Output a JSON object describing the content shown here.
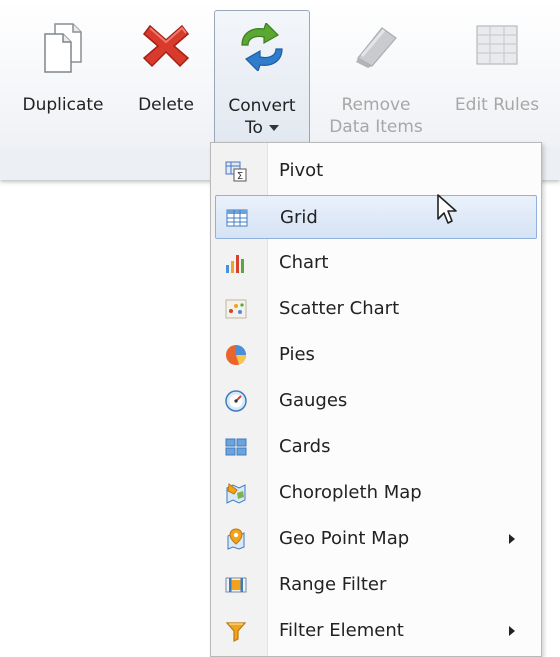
{
  "toolbar": {
    "duplicate_label": "Duplicate",
    "delete_label": "Delete",
    "convert_label_line1": "Convert",
    "convert_label_line2": "To",
    "remove_label_line1": "Remove",
    "remove_label_line2": "Data Items",
    "edit_rules_label": "Edit Rules"
  },
  "menu": {
    "items": [
      {
        "label": "Pivot",
        "icon": "pivot-icon"
      },
      {
        "label": "Grid",
        "icon": "grid-icon",
        "state": "hover"
      },
      {
        "label": "Chart",
        "icon": "chart-icon"
      },
      {
        "label": "Scatter Chart",
        "icon": "scatter-chart-icon"
      },
      {
        "label": "Pies",
        "icon": "pie-icon"
      },
      {
        "label": "Gauges",
        "icon": "gauge-icon"
      },
      {
        "label": "Cards",
        "icon": "cards-icon"
      },
      {
        "label": "Choropleth Map",
        "icon": "choropleth-map-icon"
      },
      {
        "label": "Geo Point Map",
        "icon": "geo-point-map-icon",
        "submenu": true
      },
      {
        "label": "Range Filter",
        "icon": "range-filter-icon"
      },
      {
        "label": "Filter Element",
        "icon": "filter-icon",
        "submenu": true
      }
    ]
  },
  "colors": {
    "menu_hover_border": "#8fb1dc",
    "delete_red": "#d83a2b",
    "convert_green": "#5aa832",
    "convert_blue": "#2f7ccc"
  }
}
